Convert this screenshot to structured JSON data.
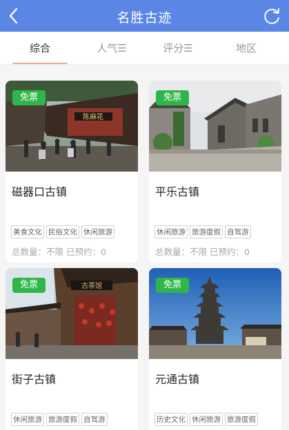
{
  "header": {
    "title": "名胜古迹",
    "back_icon": "chevron-left-icon",
    "refresh_icon": "refresh-icon",
    "bar_color": "#5b86e5"
  },
  "tabs": [
    {
      "label": "综合",
      "active": true
    },
    {
      "label": "人气☰",
      "active": false
    },
    {
      "label": "评分☰",
      "active": false
    },
    {
      "label": "地区",
      "active": false
    }
  ],
  "cards": [
    {
      "badge": "免票",
      "title": "磁器口古镇",
      "tags": [
        "美食文化",
        "民俗文化",
        "休闲旅游"
      ],
      "stats": "总数量：不限 已预约：0",
      "sign": "陈麻花"
    },
    {
      "badge": "免票",
      "title": "平乐古镇",
      "tags": [
        "休闲旅游",
        "旅游度假",
        "自驾游"
      ],
      "stats": "总数量：不限 已预约：0"
    },
    {
      "badge": "免票",
      "title": "街子古镇",
      "tags": [
        "休闲旅游",
        "旅游度假",
        "自驾游"
      ],
      "sign": "古茶馆"
    },
    {
      "badge": "免票",
      "title": "元通古镇",
      "tags": [
        "历史文化",
        "休闲旅游",
        "旅游度假"
      ]
    }
  ]
}
